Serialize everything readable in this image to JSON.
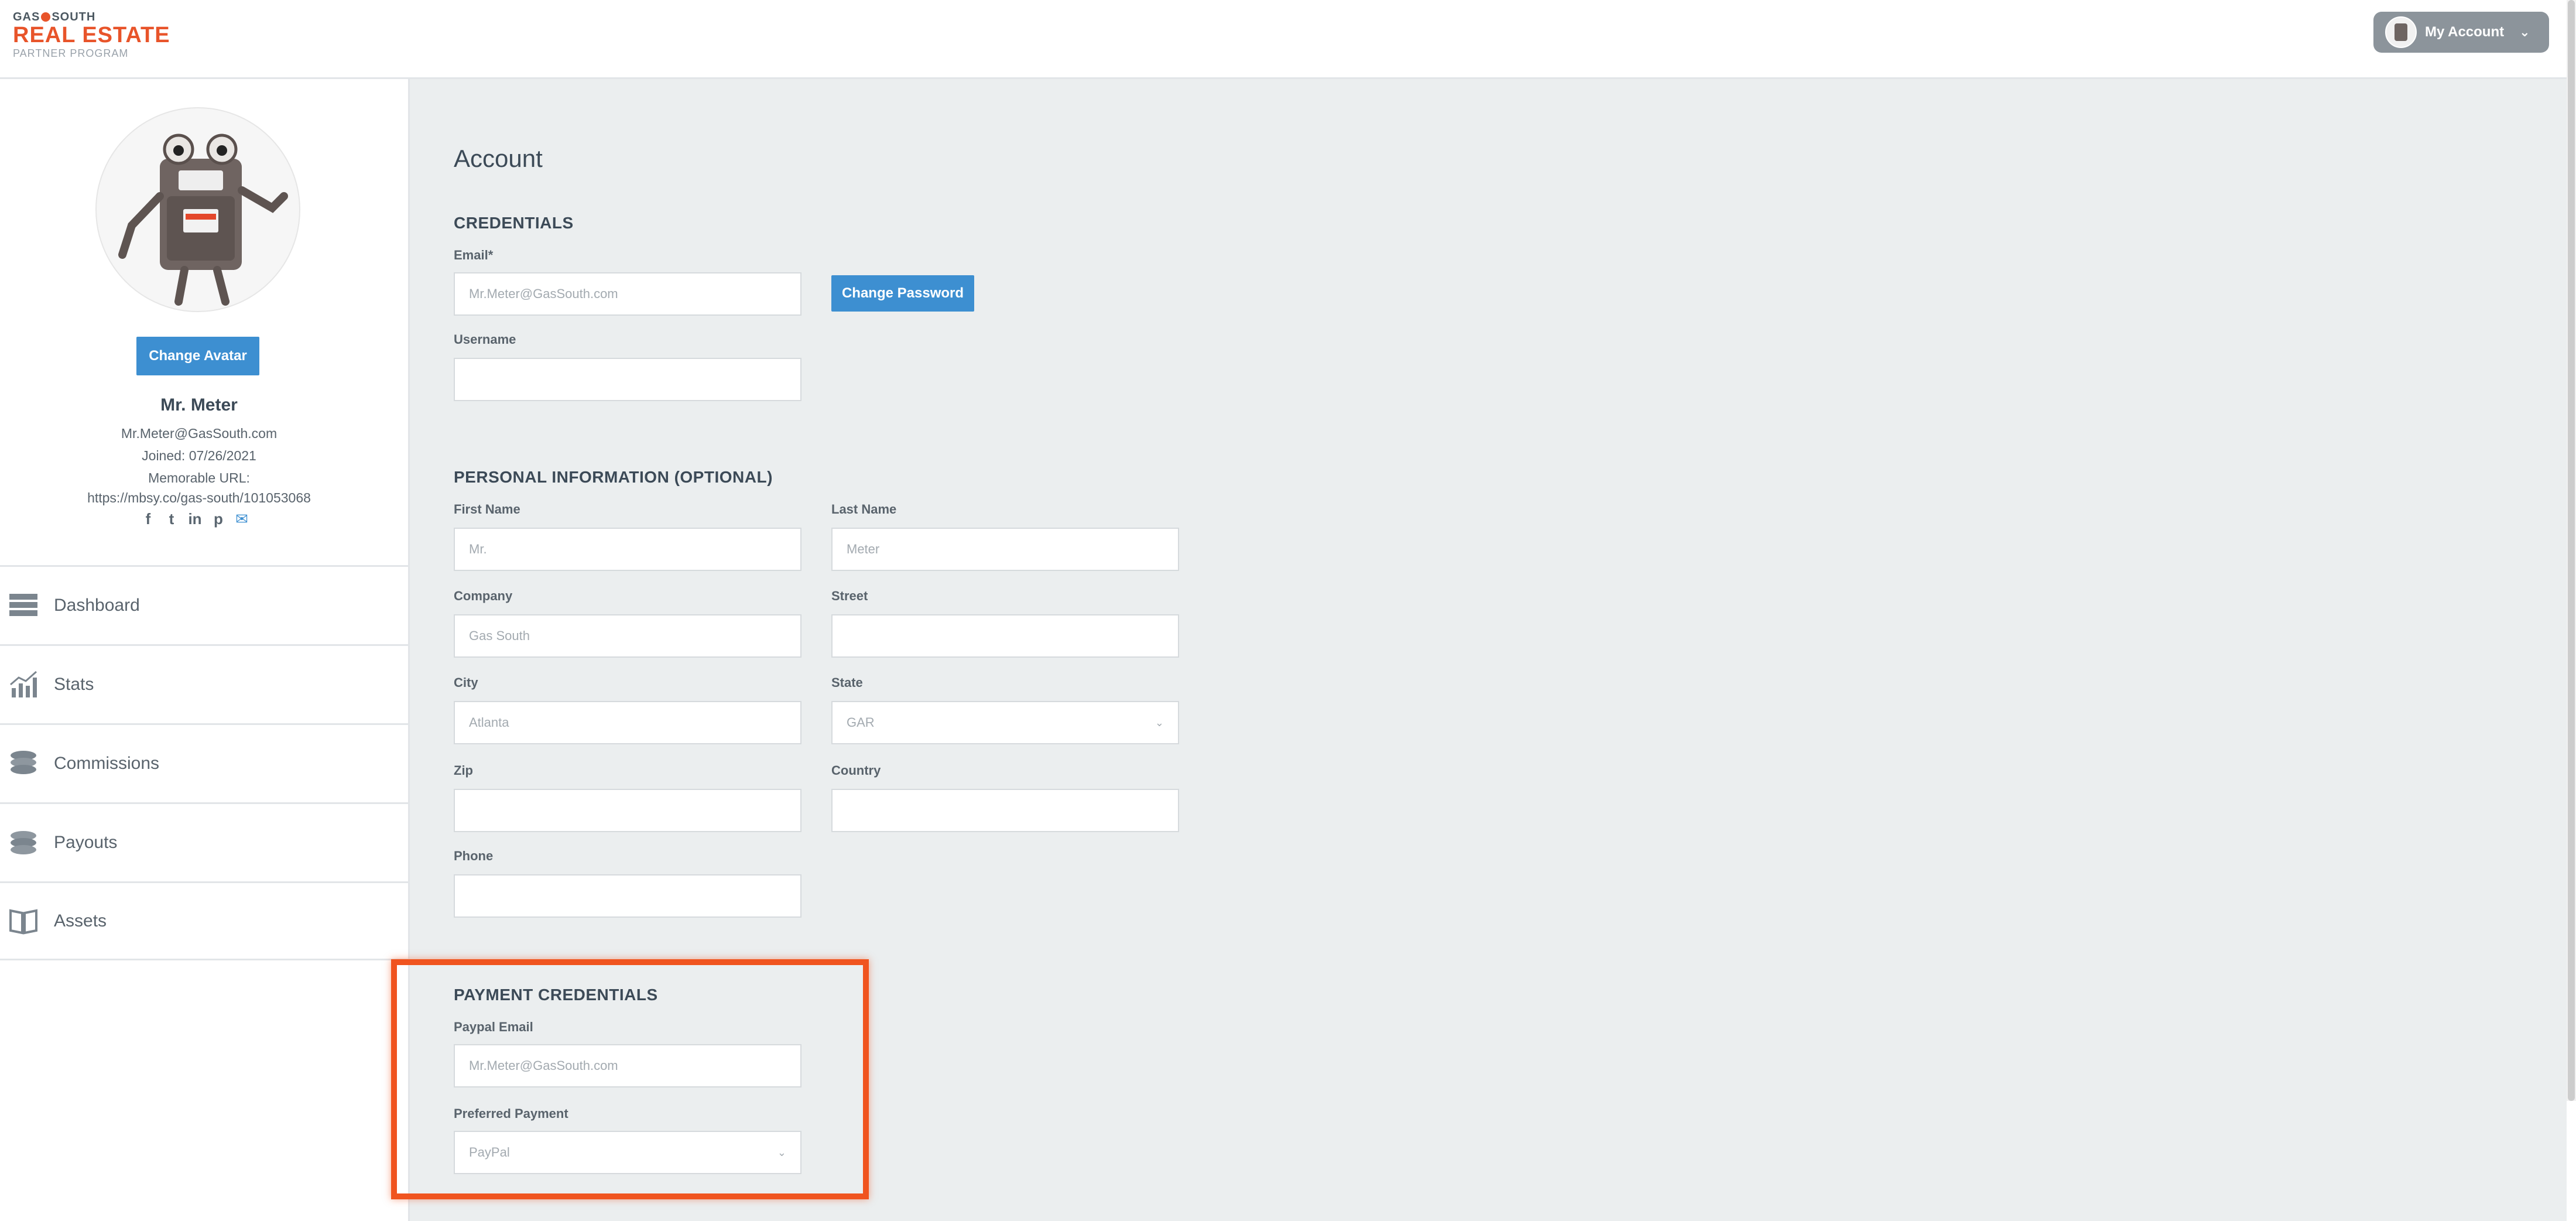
{
  "header": {
    "logo": {
      "line1a": "GAS",
      "line1b": "SOUTH",
      "line2": "REAL ESTATE",
      "line3": "PARTNER PROGRAM"
    },
    "account_label": "My Account",
    "account_caret_icon": "chevron-down-icon"
  },
  "profile": {
    "change_avatar_label": "Change Avatar",
    "name": "Mr. Meter",
    "email": "Mr.Meter@GasSouth.com",
    "joined": "Joined: 07/26/2021",
    "memorable_label": "Memorable URL:",
    "memorable_url": "https://mbsy.co/gas-south/101053068",
    "socials": [
      {
        "icon": "facebook-icon",
        "glyph": "f"
      },
      {
        "icon": "twitter-icon",
        "glyph": "t"
      },
      {
        "icon": "linkedin-icon",
        "glyph": "in"
      },
      {
        "icon": "pinterest-icon",
        "glyph": "p"
      },
      {
        "icon": "email-icon",
        "glyph": "✉"
      }
    ]
  },
  "nav": {
    "items": [
      {
        "label": "Dashboard",
        "icon": "dashboard-icon"
      },
      {
        "label": "Stats",
        "icon": "stats-icon"
      },
      {
        "label": "Commissions",
        "icon": "coins-icon"
      },
      {
        "label": "Payouts",
        "icon": "payouts-icon"
      },
      {
        "label": "Assets",
        "icon": "book-icon"
      }
    ]
  },
  "main": {
    "title": "Account",
    "credentials": {
      "heading": "CREDENTIALS",
      "email_label": "Email*",
      "email_value": "Mr.Meter@GasSouth.com",
      "change_password_label": "Change Password",
      "username_label": "Username",
      "username_value": ""
    },
    "personal": {
      "heading": "PERSONAL INFORMATION (OPTIONAL)",
      "first_name_label": "First Name",
      "first_name_value": "Mr.",
      "last_name_label": "Last Name",
      "last_name_value": "Meter",
      "company_label": "Company",
      "company_value": "Gas South",
      "street_label": "Street",
      "street_value": "",
      "city_label": "City",
      "city_value": "Atlanta",
      "state_label": "State",
      "state_value": "GAR",
      "zip_label": "Zip",
      "zip_value": "",
      "country_label": "Country",
      "country_value": "",
      "phone_label": "Phone",
      "phone_value": ""
    },
    "payment": {
      "heading": "PAYMENT CREDENTIALS",
      "paypal_email_label": "Paypal Email",
      "paypal_email_value": "Mr.Meter@GasSouth.com",
      "preferred_payment_label": "Preferred Payment",
      "preferred_payment_value": "PayPal"
    }
  },
  "colors": {
    "accent": "#3d8fd1",
    "brand": "#e8542a",
    "highlight": "#f0541f",
    "background": "#ebeeef"
  }
}
